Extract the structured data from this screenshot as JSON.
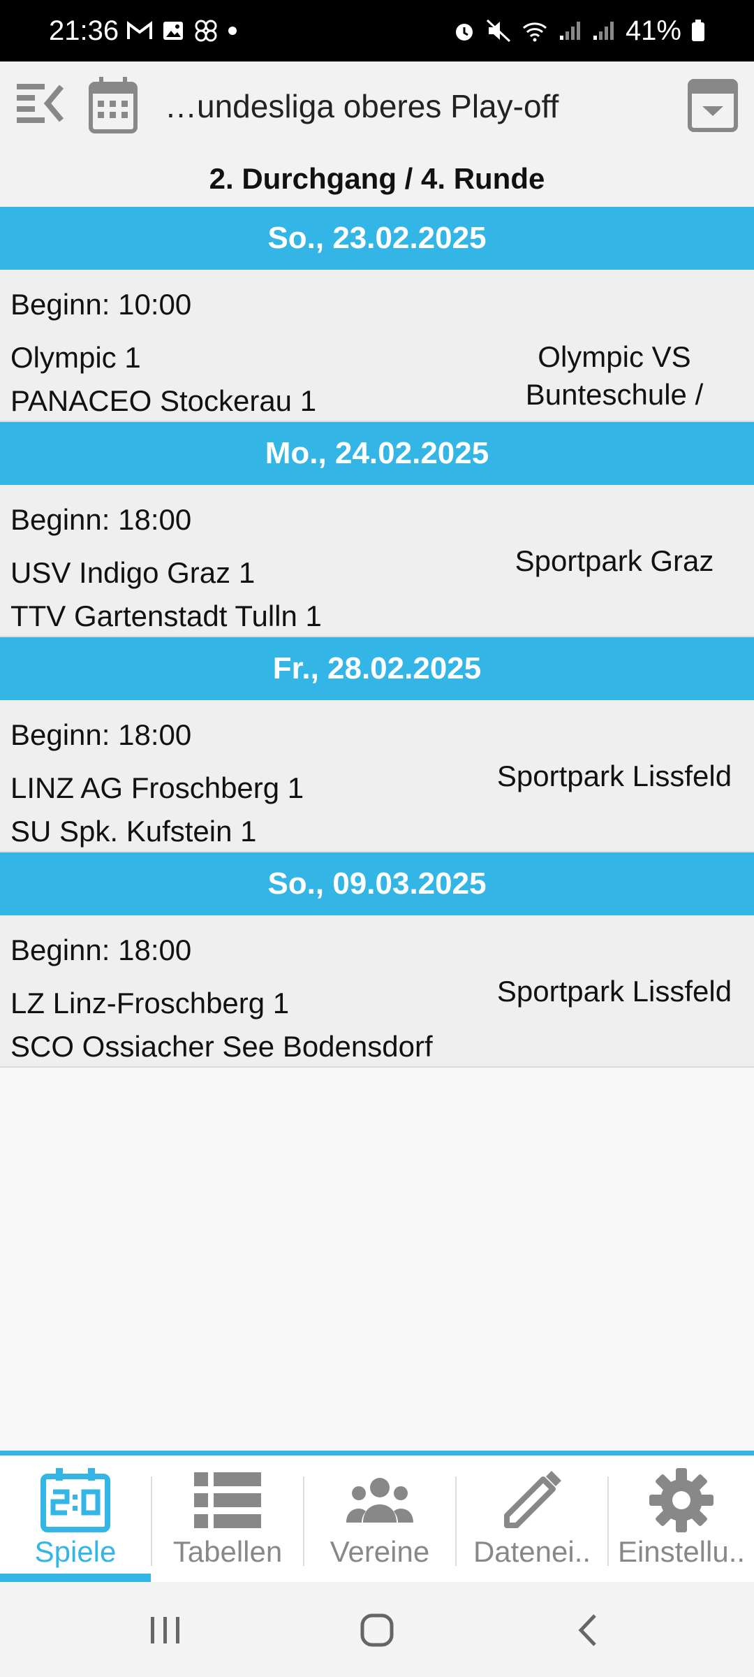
{
  "status_bar": {
    "time": "21:36",
    "battery": "41%"
  },
  "app_bar": {
    "title": "…undesliga oberes Play-off"
  },
  "subtitle": "2. Durchgang / 4. Runde",
  "days": [
    {
      "date": "So., 23.02.2025",
      "start": "Beginn: 10:00",
      "home": "Olympic 1",
      "away": "PANACEO Stockerau 1",
      "venue_lines": [
        "Olympic VS",
        "Bunteschule /"
      ]
    },
    {
      "date": "Mo., 24.02.2025",
      "start": "Beginn: 18:00",
      "home": "USV Indigo Graz 1",
      "away": "TTV Gartenstadt Tulln 1",
      "venue_lines": [
        "Sportpark Graz"
      ]
    },
    {
      "date": "Fr., 28.02.2025",
      "start": "Beginn: 18:00",
      "home": "LINZ AG Froschberg 1",
      "away": "SU Spk. Kufstein 1",
      "venue_lines": [
        "Sportpark Lissfeld"
      ]
    },
    {
      "date": "So., 09.03.2025",
      "start": "Beginn: 18:00",
      "home": "LZ Linz-Froschberg 1",
      "away": "SCO Ossiacher See Bodensdorf",
      "venue_lines": [
        "Sportpark Lissfeld"
      ]
    }
  ],
  "bottom_nav": [
    {
      "label": "Spiele",
      "icon": "scoreboard-icon",
      "active": true
    },
    {
      "label": "Tabellen",
      "icon": "list-icon",
      "active": false
    },
    {
      "label": "Vereine",
      "icon": "people-icon",
      "active": false
    },
    {
      "label": "Datenei..",
      "icon": "pencil-icon",
      "active": false
    },
    {
      "label": "Einstellu..",
      "icon": "gear-icon",
      "active": false
    }
  ],
  "colors": {
    "accent": "#33b5e5",
    "inactive": "#888888"
  }
}
